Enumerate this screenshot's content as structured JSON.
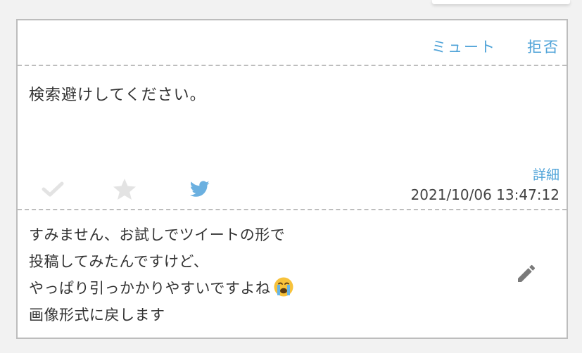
{
  "header": {
    "mute_label": "ミュート",
    "reject_label": "拒否"
  },
  "question": {
    "text": "検索避けしてください。",
    "details_label": "詳細",
    "timestamp": "2021/10/06 13:47:12"
  },
  "icons": {
    "check": "check-icon",
    "star": "star-icon",
    "twitter": "twitter-icon",
    "edit": "pencil-icon",
    "emoji": "crying-face-emoji"
  },
  "answer": {
    "lines": [
      "すみません、お試しでツイートの形で",
      "投稿してみたんですけど、",
      "やっぱり引っかかりやすいですよね",
      "画像形式に戻します"
    ]
  },
  "colors": {
    "link": "#4fa3d8",
    "icon_inactive": "#e3e3e3",
    "twitter": "#6bb0e0",
    "border": "#bdbdbd"
  }
}
